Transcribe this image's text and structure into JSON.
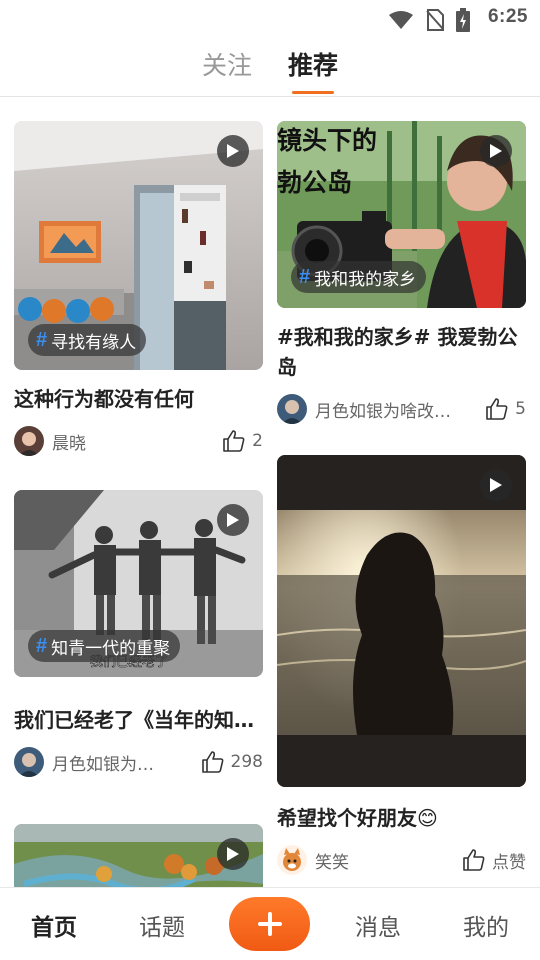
{
  "status_bar": {
    "time": "6:25"
  },
  "top_tabs": [
    {
      "label": "关注",
      "active": false
    },
    {
      "label": "推荐",
      "active": true
    }
  ],
  "feed": {
    "left": [
      {
        "tag": "寻找有缘人",
        "title": "这种行为都没有任何",
        "author": "晨晓",
        "likes": "2"
      },
      {
        "tag": "知青一代的重聚",
        "overlay_caption": "我们已经老了",
        "title": "我们已经老了《当年的知…",
        "author": "月色如银为…",
        "likes": "298"
      },
      {
        "tag": "",
        "title": "",
        "author": "",
        "likes": ""
      }
    ],
    "right": [
      {
        "tag": "我和我的家乡",
        "overlay_text": "镜头下的勃公岛",
        "title": "#我和我的家乡# 我爱勃公岛",
        "author": "月色如银为啥改…",
        "likes": "5"
      },
      {
        "tag": "",
        "title": "希望找个好朋友😊",
        "author": "笑笑",
        "likes": "点赞"
      }
    ]
  },
  "bottom_nav": {
    "items": [
      {
        "label": "首页",
        "active": true
      },
      {
        "label": "话题",
        "active": false
      },
      {
        "label": "消息",
        "active": false
      },
      {
        "label": "我的",
        "active": false
      }
    ],
    "add_icon": "plus-icon"
  },
  "colors": {
    "accent": "#f07020",
    "hashtag": "#3a8ff0"
  }
}
